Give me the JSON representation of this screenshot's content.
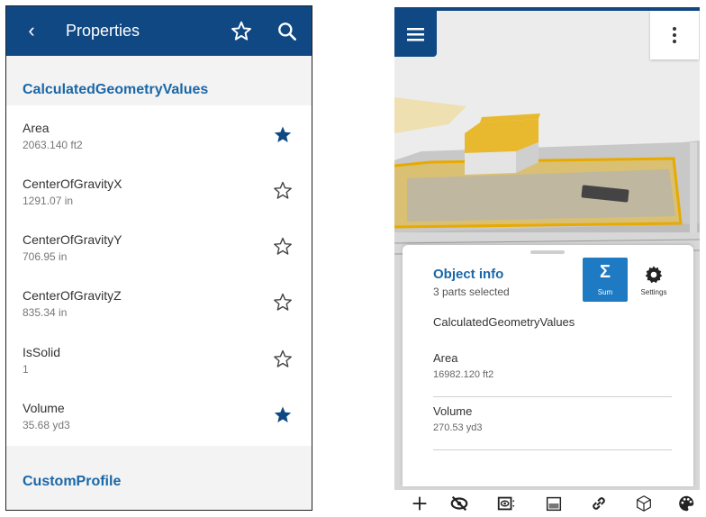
{
  "left": {
    "header": {
      "back_label": "‹",
      "title": "Properties"
    },
    "sections": [
      {
        "title": "CalculatedGeometryValues"
      },
      {
        "title": "CustomProfile"
      }
    ],
    "properties": [
      {
        "name": "Area",
        "value": "2063.140 ft2",
        "favorite": true
      },
      {
        "name": "CenterOfGravityX",
        "value": "1291.07 in",
        "favorite": false
      },
      {
        "name": "CenterOfGravityY",
        "value": "706.95 in",
        "favorite": false
      },
      {
        "name": "CenterOfGravityZ",
        "value": "835.34 in",
        "favorite": false
      },
      {
        "name": "IsSolid",
        "value": "1",
        "favorite": false
      },
      {
        "name": "Volume",
        "value": "35.68 yd3",
        "favorite": true
      }
    ],
    "icons": [
      "back-icon",
      "star-outline-icon",
      "search-icon",
      "star-filled-icon"
    ]
  },
  "right": {
    "panel": {
      "title": "Object info",
      "subtitle": "3 parts selected",
      "sum_glyph": "Σ",
      "sum_label": "Sum",
      "settings_label": "Settings",
      "section": "CalculatedGeometryValues",
      "rows": [
        {
          "name": "Area",
          "value": "16982.120 ft2"
        },
        {
          "name": "Volume",
          "value": "270.53 yd3"
        }
      ]
    },
    "toolbar_icons": [
      "add-icon",
      "hide-icon",
      "isolate-icon",
      "transparency-icon",
      "link-icon",
      "cube-icon",
      "palette-icon"
    ],
    "colors": {
      "header": "#0f4883",
      "accent": "#1a67a8",
      "sum_button": "#1e7ac2",
      "highlight": "#e8b92e"
    }
  }
}
